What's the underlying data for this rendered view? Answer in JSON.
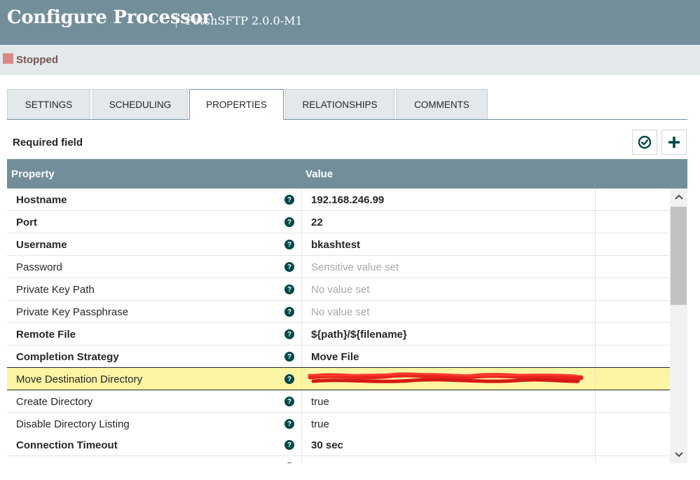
{
  "header": {
    "title": "Configure Processor",
    "subtitle": "FetchSFTP 2.0.0-M1"
  },
  "status": {
    "label": "Stopped",
    "color": "#d48a8a"
  },
  "tabs": [
    {
      "label": "SETTINGS"
    },
    {
      "label": "SCHEDULING"
    },
    {
      "label": "PROPERTIES",
      "active": true
    },
    {
      "label": "RELATIONSHIPS"
    },
    {
      "label": "COMMENTS"
    }
  ],
  "properties_panel": {
    "required_label": "Required field",
    "verify_icon": "check-circle-icon",
    "add_icon": "plus-icon",
    "columns": {
      "property": "Property",
      "value": "Value"
    },
    "rows": [
      {
        "name": "Hostname",
        "required": true,
        "value": "192.168.246.99",
        "value_style": "bold"
      },
      {
        "name": "Port",
        "required": true,
        "value": "22",
        "value_style": "bold"
      },
      {
        "name": "Username",
        "required": true,
        "value": "bkashtest",
        "value_style": "bold"
      },
      {
        "name": "Password",
        "required": false,
        "value": "Sensitive value set",
        "value_style": "muted"
      },
      {
        "name": "Private Key Path",
        "required": false,
        "value": "No value set",
        "value_style": "muted"
      },
      {
        "name": "Private Key Passphrase",
        "required": false,
        "value": "No value set",
        "value_style": "muted"
      },
      {
        "name": "Remote File",
        "required": true,
        "value": "${path}/${filename}",
        "value_style": "bold"
      },
      {
        "name": "Completion Strategy",
        "required": true,
        "value": "Move File",
        "value_style": "bold"
      },
      {
        "name": "Move Destination Directory",
        "required": false,
        "value": "",
        "value_style": "redacted",
        "highlighted": true
      },
      {
        "name": "Create Directory",
        "required": false,
        "value": "true",
        "value_style": "normal"
      },
      {
        "name": "Disable Directory Listing",
        "required": false,
        "value": "true",
        "value_style": "normal"
      },
      {
        "name": "Connection Timeout",
        "required": true,
        "value": "30 sec",
        "value_style": "bold"
      }
    ]
  },
  "colors": {
    "header_bg": "#728e9b",
    "highlight_row": "#fcf5a4",
    "help_icon": "#004849"
  }
}
